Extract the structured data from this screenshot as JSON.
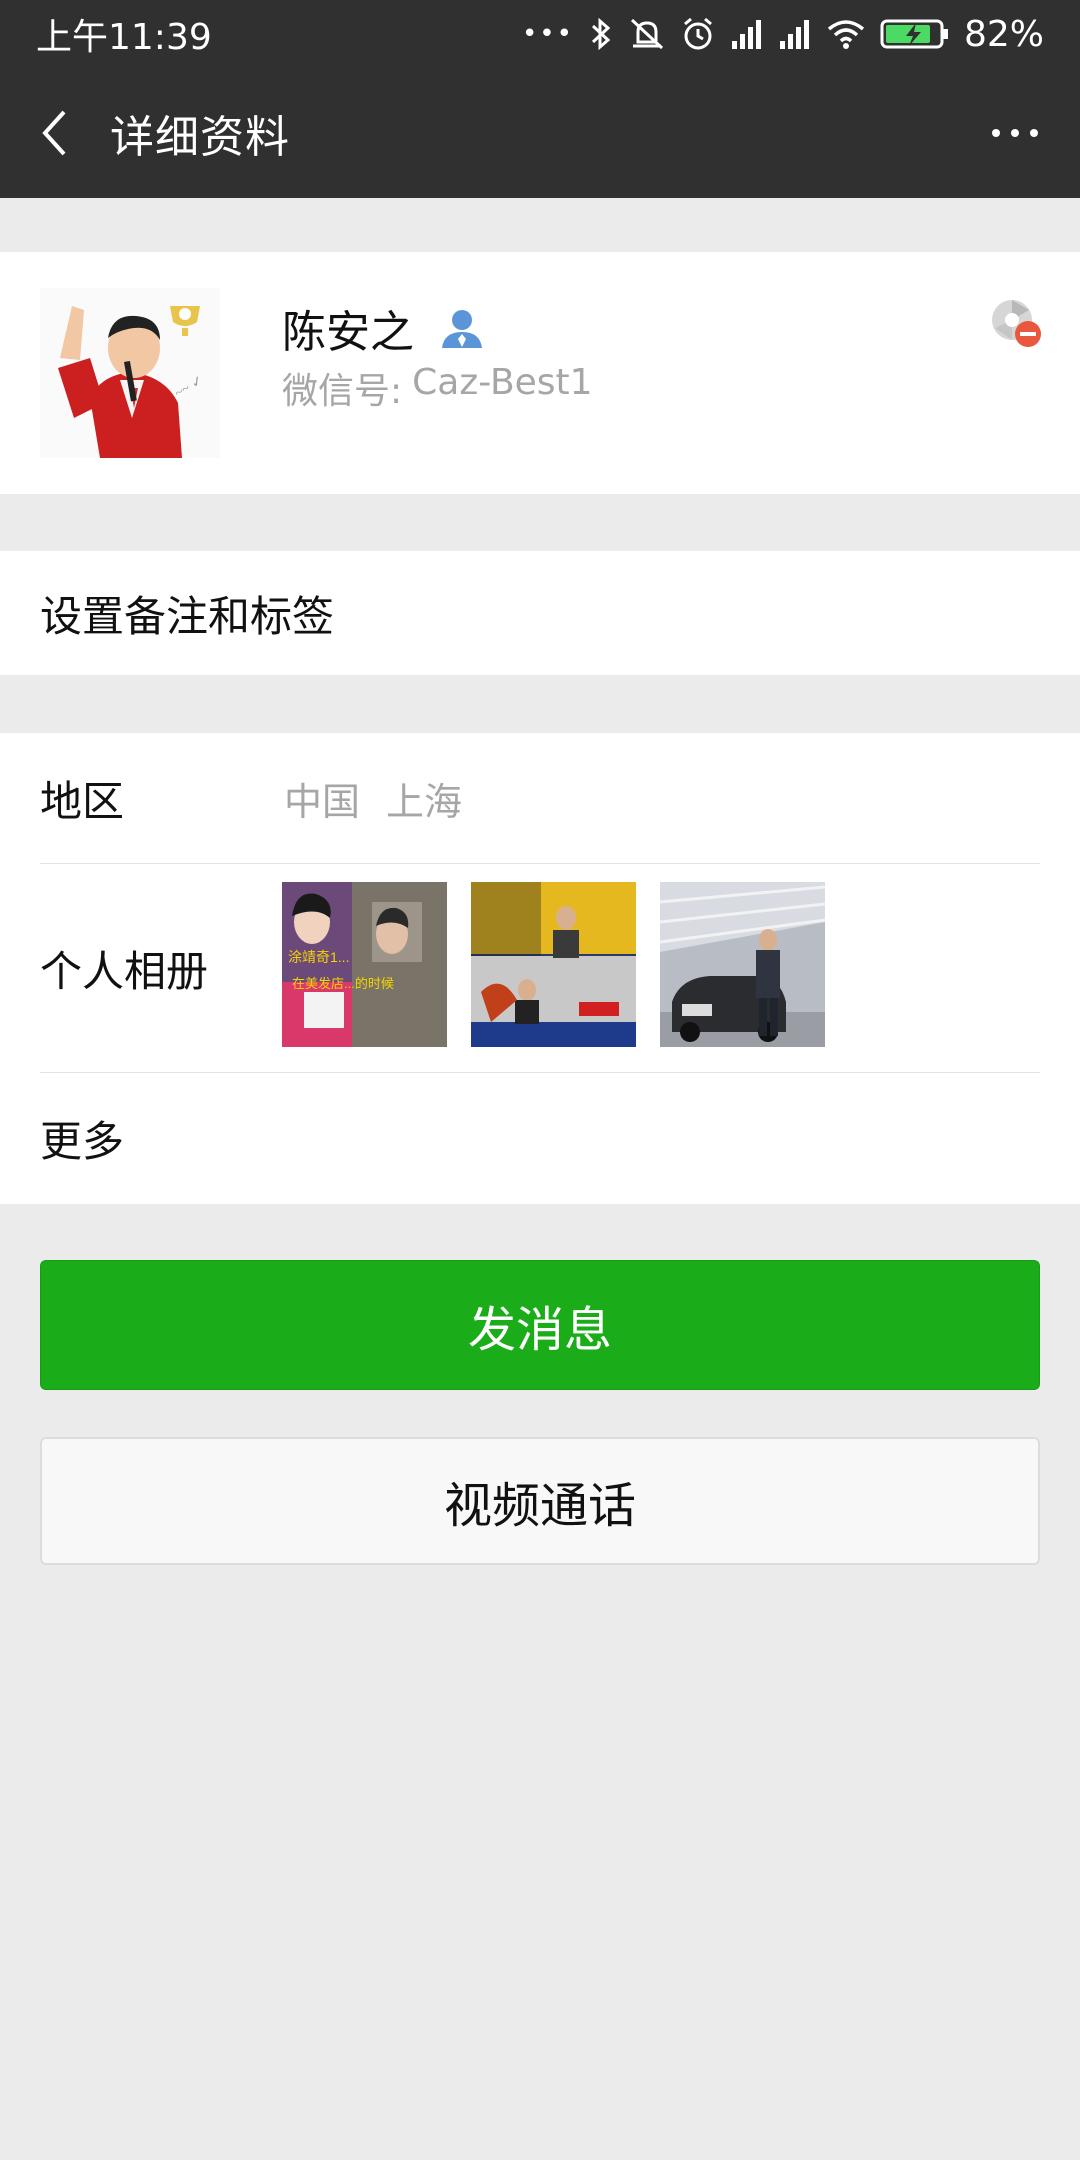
{
  "status_bar": {
    "time": "上午11:39",
    "dots": "•••",
    "battery_percent": "82%",
    "icons": [
      "bluetooth-icon",
      "mute-icon",
      "alarm-icon",
      "signal-icon",
      "signal-icon",
      "wifi-icon",
      "battery-charging-icon"
    ]
  },
  "app_bar": {
    "title": "详细资料",
    "back_icon": "chevron-left-icon",
    "more_icon": "more-horizontal-icon"
  },
  "profile": {
    "name": "陈安之",
    "wechat_id_label": "微信号:",
    "wechat_id": "Caz-Best1",
    "name_badge_icon": "contact-person-icon",
    "status_icon": "blocked-moments-icon"
  },
  "remark": {
    "label": "设置备注和标签"
  },
  "info": {
    "region_label": "地区",
    "region_country": "中国",
    "region_city": "上海",
    "album_label": "个人相册",
    "album_captions": [
      "涂靖奇1...",
      "在美发店...的时候"
    ],
    "more_label": "更多"
  },
  "actions": {
    "send_message": "发消息",
    "video_call": "视频通话"
  },
  "colors": {
    "header_bg": "#303030",
    "page_bg": "#ebebeb",
    "primary_green": "#1aad19",
    "secondary_text": "#a6a6a6"
  }
}
